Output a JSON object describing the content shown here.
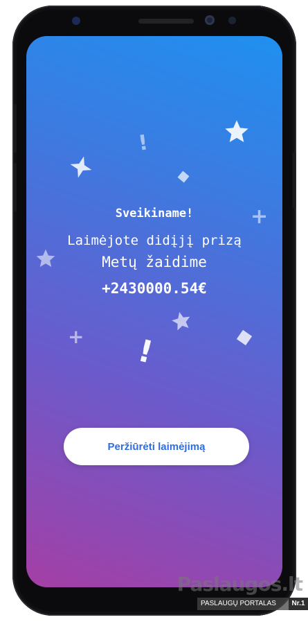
{
  "message": {
    "title": "Sveikiname!",
    "line1": "Laimėjote didįjį prizą",
    "line2": "Metų žaidime",
    "amount": "+2430000.54€"
  },
  "cta": {
    "label": "Peržiūrėti laimėjimą"
  },
  "watermark": {
    "logo": "Paslaugos.lt",
    "tagline": "PASLAUGŲ PORTALAS",
    "rank": "Nr.1"
  },
  "colors": {
    "gradient_top": "#1f90f0",
    "gradient_bottom": "#a43fa5",
    "button_text": "#2f6de0"
  },
  "decorations": [
    "sparkle-icon",
    "star-icon",
    "exclamation-icon",
    "plus-icon",
    "diamond-icon"
  ]
}
